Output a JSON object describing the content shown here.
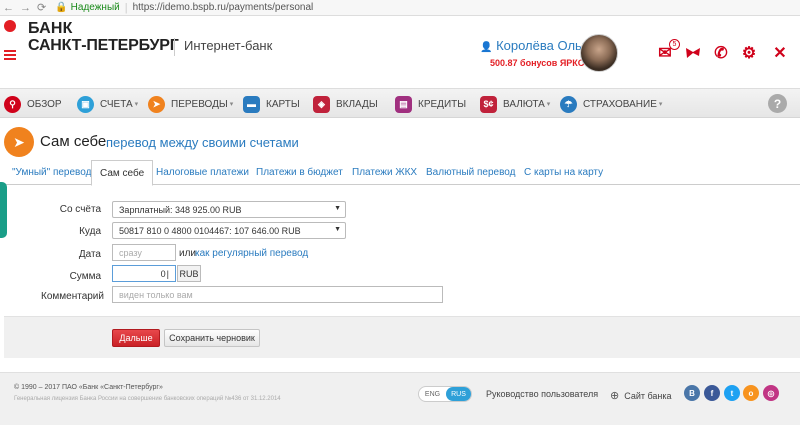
{
  "browser": {
    "secure_label": "Надежный",
    "url": "https://idemo.bspb.ru/payments/personal"
  },
  "header": {
    "logo_line1": "БАНК",
    "logo_line2": "САНКТ-ПЕТЕРБУРГ",
    "subtitle": "Интернет-банк",
    "user_name": "Королёва Ольга",
    "bonus": "500.87 бонусов ЯРКО",
    "mail_badge": "5"
  },
  "menu": [
    {
      "label": "ОБЗОР",
      "color": "#d0021b"
    },
    {
      "label": "СЧЕТА",
      "color": "#2ea0d8"
    },
    {
      "label": "ПЕРЕВОДЫ",
      "color": "#f0821e"
    },
    {
      "label": "КАРТЫ",
      "color": "#2a7bbf"
    },
    {
      "label": "ВКЛАДЫ",
      "color": "#c0223b"
    },
    {
      "label": "КРЕДИТЫ",
      "color": "#a0307f"
    },
    {
      "label": "ВАЛЮТА",
      "color": "#c0223b"
    },
    {
      "label": "СТРАХОВАНИЕ",
      "color": "#2a7bbf"
    }
  ],
  "page": {
    "title": "Сам себе",
    "subtitle": "перевод между своими счетами"
  },
  "tabs": [
    {
      "label": "\"Умный\" перевод",
      "active": false
    },
    {
      "label": "Сам себе",
      "active": true
    },
    {
      "label": "Налоговые платежи",
      "active": false
    },
    {
      "label": "Платежи в бюджет",
      "active": false
    },
    {
      "label": "Платежи ЖКХ",
      "active": false
    },
    {
      "label": "Валютный перевод",
      "active": false
    },
    {
      "label": "С карты на карту",
      "active": false
    }
  ],
  "form": {
    "from_label": "Со счёта",
    "from_value": "Зарплатный: 348 925.00 RUB",
    "to_label": "Куда",
    "to_value": "50817 810 0 4800 0104467: 107 646.00 RUB",
    "date_label": "Дата",
    "date_placeholder": "сразу",
    "date_or": "или",
    "date_link": "как регулярный перевод",
    "amount_label": "Сумма",
    "amount_value": "0",
    "currency": "RUB",
    "comment_label": "Комментарий",
    "comment_placeholder": "виден только вам"
  },
  "actions": {
    "next": "Дальше",
    "save_draft": "Сохранить черновик"
  },
  "footer": {
    "copyright": "© 1990 – 2017 ПАО «Банк «Санкт-Петербург»",
    "license": "Генеральная лицензия Банка России на совершение банковских операций №436 от 31.12.2014",
    "lang_eng": "ENG",
    "lang_rus": "RUS",
    "guide": "Руководство пользователя",
    "site": "Сайт банка",
    "social": [
      {
        "name": "vk",
        "glyph": "B",
        "color": "#4a76a8"
      },
      {
        "name": "facebook",
        "glyph": "f",
        "color": "#3b5998"
      },
      {
        "name": "twitter",
        "glyph": "t",
        "color": "#1da1f2"
      },
      {
        "name": "odnoklassniki",
        "glyph": "o",
        "color": "#f7931e"
      },
      {
        "name": "instagram",
        "glyph": "◎",
        "color": "#c13584"
      }
    ]
  }
}
